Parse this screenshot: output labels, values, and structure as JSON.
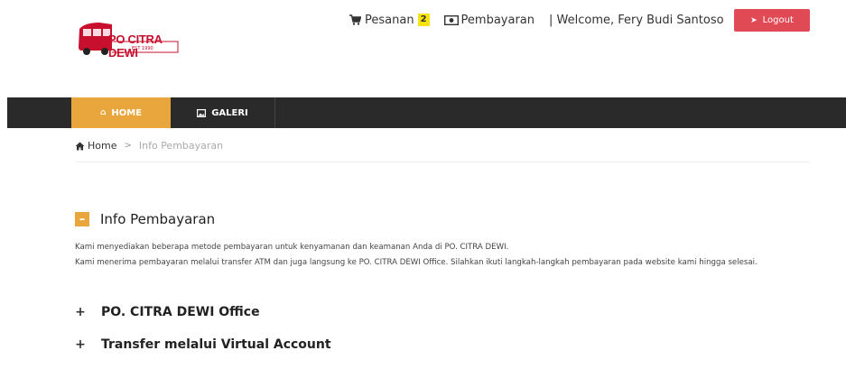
{
  "brand": {
    "logo_text": "PO CITRA DEWI",
    "logo_sub": "EST 1990"
  },
  "topnav": {
    "orders_label": "Pesanan",
    "orders_count": "2",
    "payment_label": "Pembayaran",
    "welcome": "| Welcome, Fery Budi Santoso",
    "logout_label": "Logout"
  },
  "navbar": {
    "items": [
      {
        "label": "HOME",
        "icon": "home-icon",
        "active": true
      },
      {
        "label": "GALERI",
        "icon": "image-icon",
        "active": false
      }
    ]
  },
  "breadcrumb": {
    "home": "Home",
    "separator": ">",
    "current": "Info Pembayaran"
  },
  "content": {
    "title": "Info Pembayaran",
    "paragraph_1": "Kami menyediakan beberapa metode pembayaran untuk kenyamanan dan keamanan Anda di PO. CITRA DEWI.",
    "paragraph_2": "Kami menerima pembayaran melalui transfer ATM dan juga langsung ke PO. CITRA DEWI Office. Silahkan ikuti langkah-langkah pembayaran pada website kami hingga selesai.",
    "accordions": [
      {
        "label": "PO. CITRA DEWI Office"
      },
      {
        "label": "Transfer melalui Virtual Account"
      }
    ]
  },
  "colors": {
    "accent": "#e8a63c",
    "logout": "#e04a55",
    "navbar": "#2a2a2a",
    "badge": "#f5e312",
    "brand_red": "#c8102e"
  }
}
